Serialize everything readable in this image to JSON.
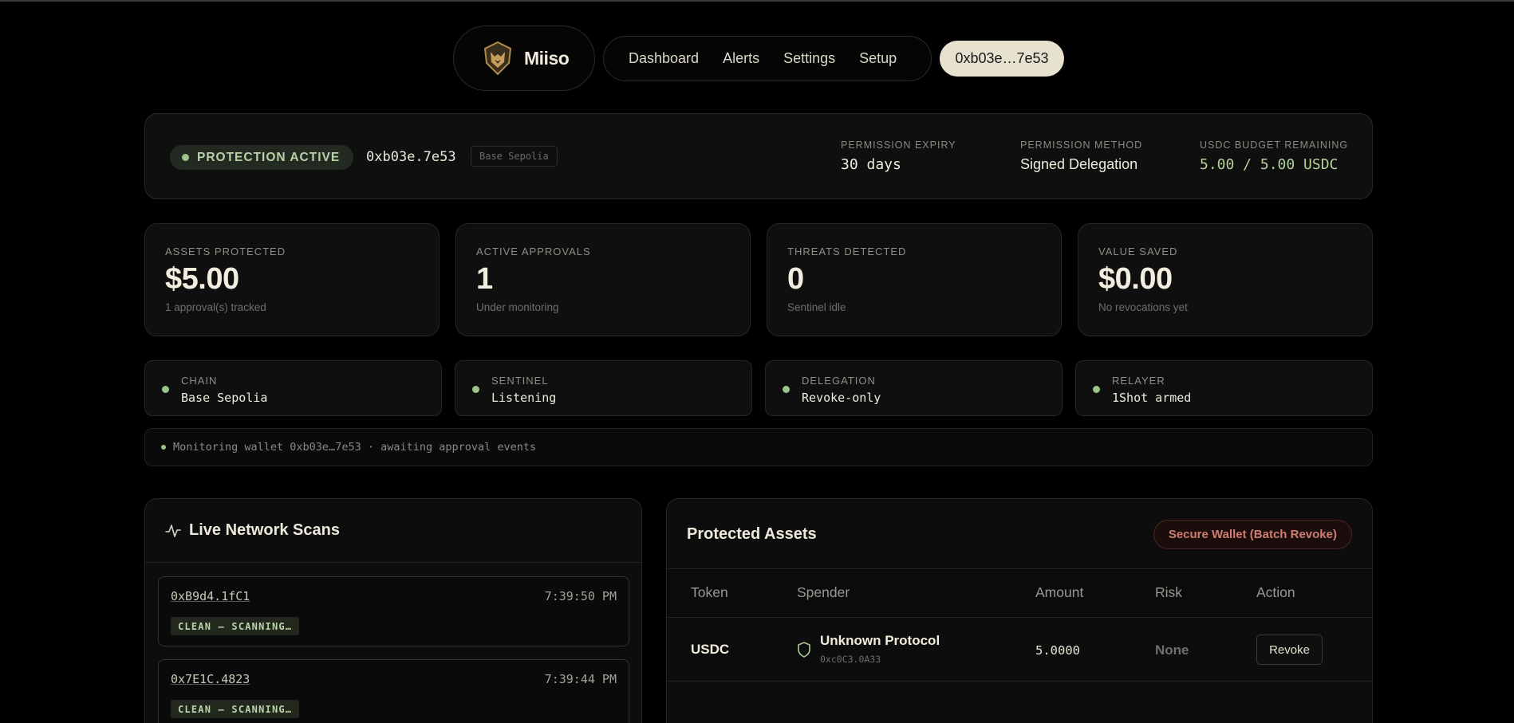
{
  "header": {
    "brand_name": "Miiso",
    "nav": [
      "Dashboard",
      "Alerts",
      "Settings",
      "Setup"
    ],
    "wallet_button": "0xb03e…7e53"
  },
  "status_bar": {
    "protection_label": "PROTECTION ACTIVE",
    "address": "0xb03e.7e53",
    "network": "Base Sepolia",
    "permission_expiry_label": "PERMISSION EXPIRY",
    "permission_expiry_value": "30 days",
    "permission_method_label": "PERMISSION METHOD",
    "permission_method_value": "Signed Delegation",
    "budget_label": "USDC BUDGET REMAINING",
    "budget_value": "5.00 / 5.00 USDC"
  },
  "stats": [
    {
      "label": "ASSETS PROTECTED",
      "value": "$5.00",
      "sub": "1 approval(s) tracked"
    },
    {
      "label": "ACTIVE APPROVALS",
      "value": "1",
      "sub": "Under monitoring"
    },
    {
      "label": "THREATS DETECTED",
      "value": "0",
      "sub": "Sentinel idle"
    },
    {
      "label": "VALUE SAVED",
      "value": "$0.00",
      "sub": "No revocations yet"
    }
  ],
  "systems": [
    {
      "label": "CHAIN",
      "value": "Base Sepolia"
    },
    {
      "label": "SENTINEL",
      "value": "Listening"
    },
    {
      "label": "DELEGATION",
      "value": "Revoke-only"
    },
    {
      "label": "RELAYER",
      "value": "1Shot armed"
    }
  ],
  "monitor_text": "Monitoring wallet 0xb03e…7e53 · awaiting approval events",
  "scans": {
    "title": "Live Network Scans",
    "items": [
      {
        "hash": "0xB9d4.1fC1",
        "time": "7:39:50 PM",
        "status": "CLEAN — SCANNING…"
      },
      {
        "hash": "0x7E1C.4823",
        "time": "7:39:44 PM",
        "status": "CLEAN — SCANNING…"
      }
    ]
  },
  "assets": {
    "title": "Protected Assets",
    "batch_button": "Secure Wallet (Batch Revoke)",
    "columns": [
      "Token",
      "Spender",
      "Amount",
      "Risk",
      "Action"
    ],
    "rows": [
      {
        "token": "USDC",
        "spender": "Unknown Protocol",
        "spender_address": "0xc0C3.0A33",
        "amount": "5.0000",
        "risk": "None",
        "action": "Revoke"
      }
    ]
  },
  "colors": {
    "accent_green": "#9cc48a",
    "danger": "#d07d70",
    "background": "#000000",
    "card": "#0f0f0f"
  }
}
